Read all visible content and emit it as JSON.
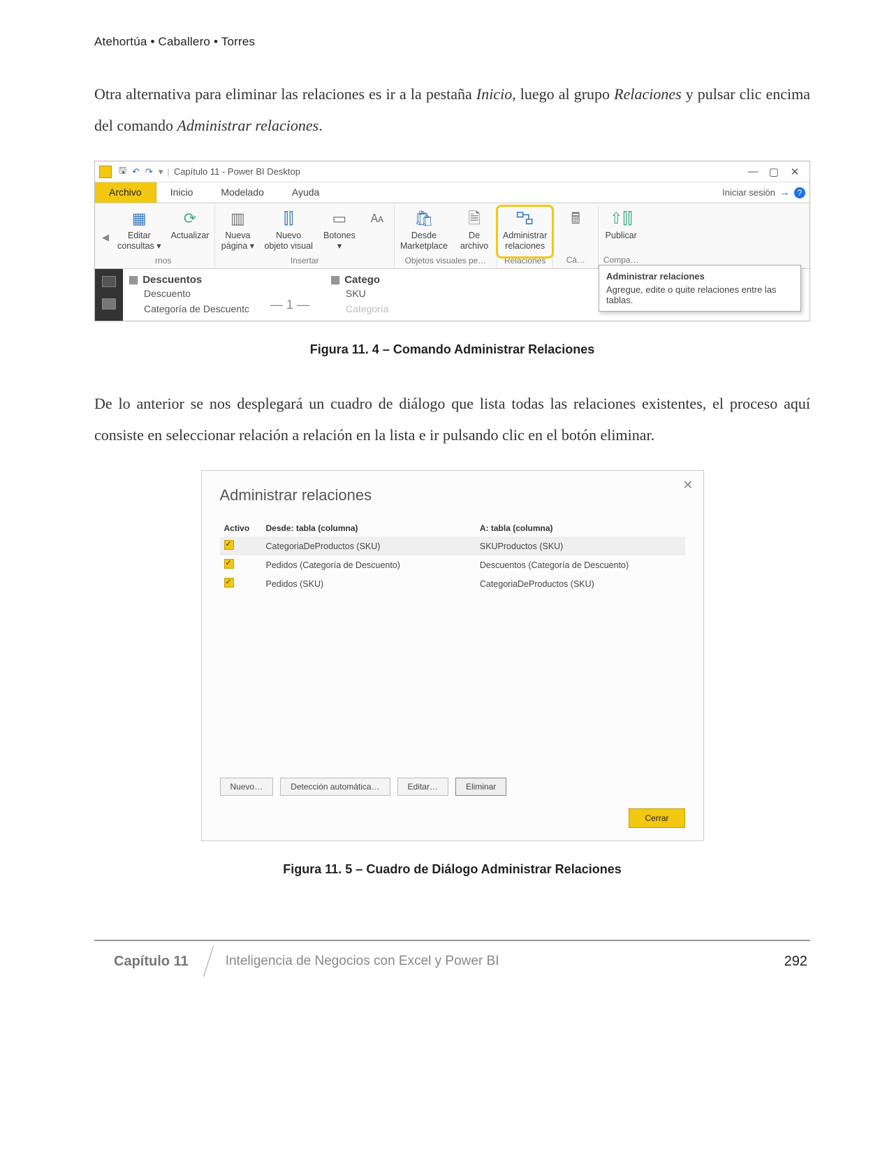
{
  "header": {
    "authors": "Atehortúa • Caballero • Torres"
  },
  "para1_a": "Otra alternativa para eliminar las relaciones es ir a la pestaña ",
  "para1_it1": "Inicio",
  "para1_b": ", luego al grupo ",
  "para1_it2": "Relaciones",
  "para1_c": " y pulsar clic encima del comando ",
  "para1_it3": "Administrar relaciones",
  "para1_d": ".",
  "pbi": {
    "title": "Capítulo 11 - Power BI Desktop",
    "tabs": {
      "file": "Archivo",
      "home": "Inicio",
      "model": "Modelado",
      "help": "Ayuda"
    },
    "signin": "Iniciar sesión",
    "ribbon": {
      "editq": "Editar\nconsultas ▾",
      "refresh": "Actualizar",
      "newpage": "Nueva\npágina ▾",
      "newvisual": "Nuevo\nobjeto visual",
      "buttons": "Botones\n▾",
      "fromMarket": "Desde\nMarketplace",
      "fromFile": "De\narchivo",
      "manageRel": "Administrar\nrelaciones",
      "publish": "Publicar",
      "g_ext_left": "rnos",
      "g_insert": "Insertar",
      "g_customv": "Objetos visuales pe…",
      "g_rel": "Relaciones",
      "g_calc": "Cá…",
      "g_compa": "Compa…"
    },
    "tooltip": {
      "title": "Administrar relaciones",
      "body": "Agregue, edite o quite relaciones entre las tablas."
    },
    "canvas": {
      "t1": "Descuentos",
      "t1f1": "Descuento",
      "t1f2": "Categoría de Descuentc",
      "t2": "Catego",
      "t2f1": "SKU",
      "t2f2": "Categoría"
    }
  },
  "caption1": "Figura 11. 4 – Comando Administrar Relaciones",
  "para2": "De lo anterior se nos desplegará un cuadro de diálogo que lista todas las relaciones existentes, el proceso aquí consiste en seleccionar relación a relación en la lista e ir pulsando clic en el botón eliminar.",
  "dlg": {
    "title": "Administrar relaciones",
    "cols": {
      "active": "Activo",
      "from": "Desde: tabla (columna)",
      "to": "A: tabla (columna)"
    },
    "rows": [
      {
        "from": "CategoriaDeProductos (SKU)",
        "to": "SKUProductos (SKU)"
      },
      {
        "from": "Pedidos (Categoría de Descuento)",
        "to": "Descuentos (Categoría de Descuento)"
      },
      {
        "from": "Pedidos (SKU)",
        "to": "CategoriaDeProductos (SKU)"
      }
    ],
    "btns": {
      "new": "Nuevo…",
      "auto": "Detección automática…",
      "edit": "Editar…",
      "del": "Eliminar",
      "close": "Cerrar"
    }
  },
  "caption2": "Figura 11. 5 – Cuadro de Diálogo Administrar Relaciones",
  "footer": {
    "chapter": "Capítulo 11",
    "title": "Inteligencia de Negocios con Excel y Power BI",
    "page": "292"
  }
}
